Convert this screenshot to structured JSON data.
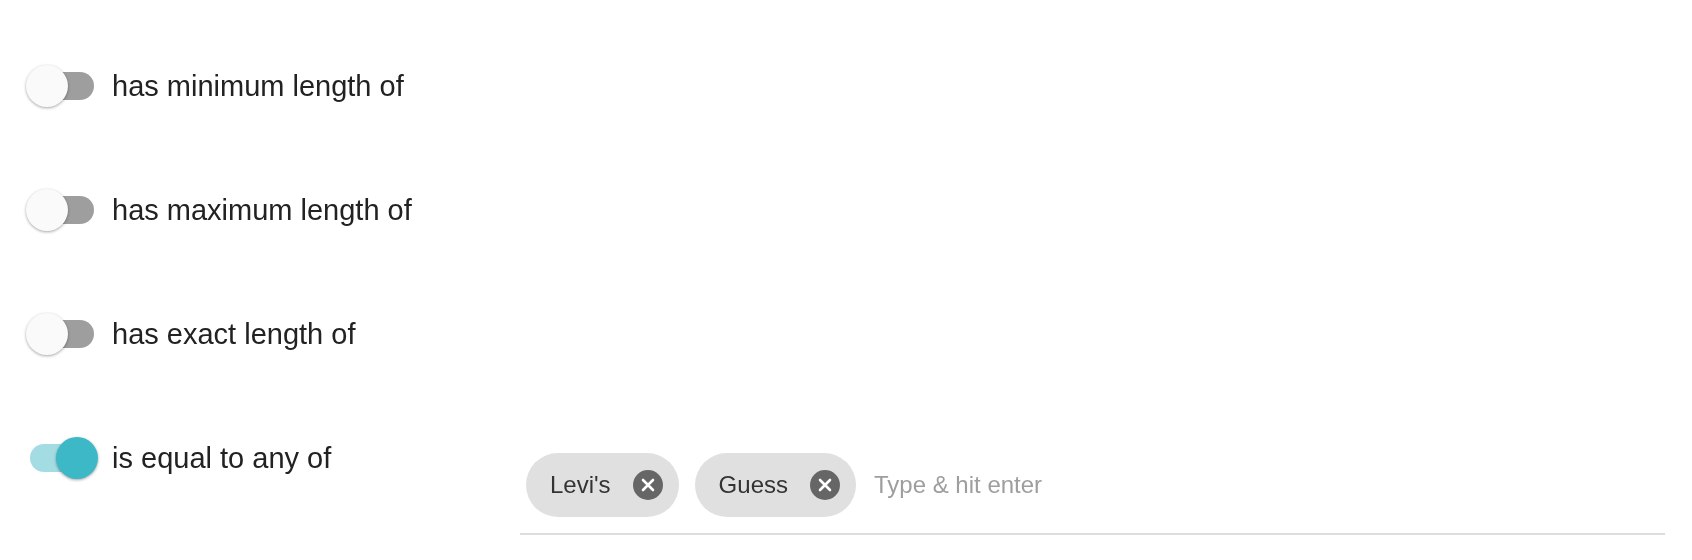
{
  "rules": [
    {
      "label": "has minimum length of",
      "on": false
    },
    {
      "label": "has maximum length of",
      "on": false
    },
    {
      "label": "has exact length of",
      "on": false
    },
    {
      "label": "is equal to any of",
      "on": true,
      "field": {
        "tags": [
          "Levi's",
          "Guess"
        ],
        "placeholder": "Type & hit enter"
      }
    }
  ]
}
